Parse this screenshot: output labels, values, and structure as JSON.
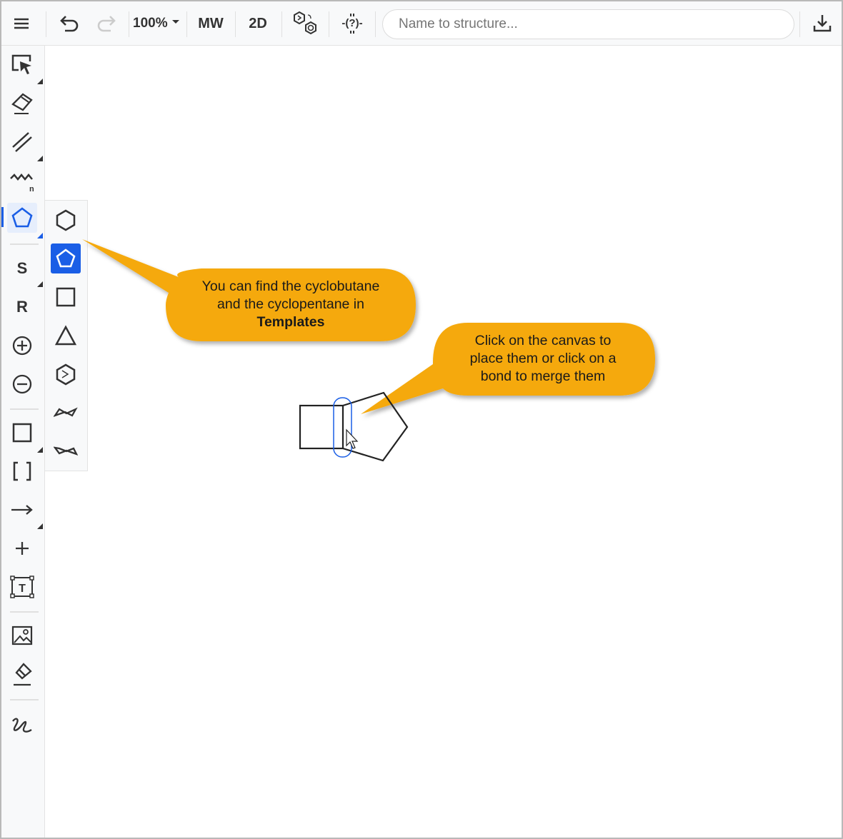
{
  "toolbar": {
    "zoom": "100%",
    "mw": "MW",
    "two_d": "2D",
    "search_placeholder": "Name to structure..."
  },
  "sidebar": {
    "s_label": "S",
    "r_label": "R"
  },
  "callouts": {
    "first_line1": "You can find the cyclobutane",
    "first_line2": "and the cyclopentane in",
    "first_bold": "Templates",
    "second_line1": "Click on the canvas to",
    "second_line2": "place them or click on a",
    "second_line3": "bond to merge them"
  },
  "colors": {
    "accent": "#1a5ee6",
    "callout": "#f5a90a",
    "icon": "#333333"
  }
}
